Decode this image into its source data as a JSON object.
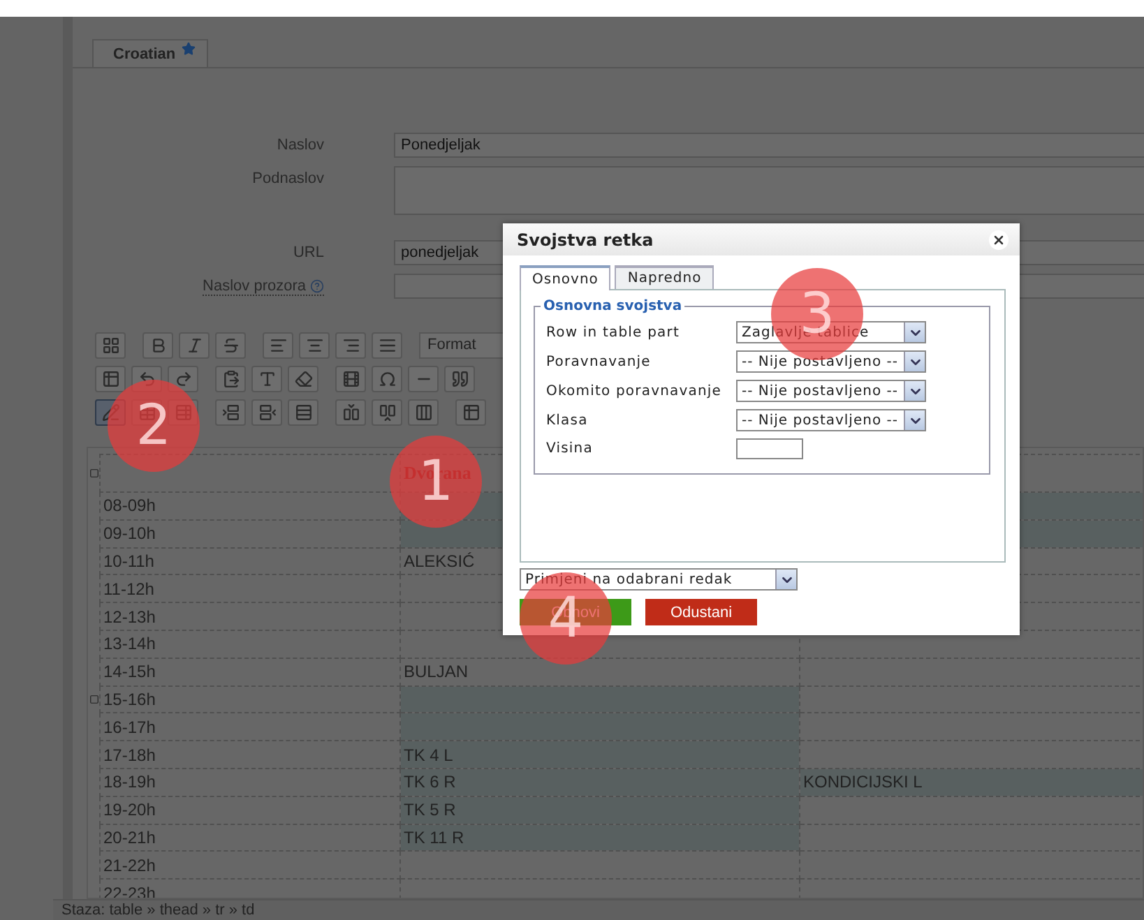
{
  "tab": {
    "label": "Croatian"
  },
  "form": [
    {
      "label": "Naslov",
      "kind": "input",
      "value": "Ponedjeljak",
      "help": false
    },
    {
      "label": "Podnaslov",
      "kind": "textarea",
      "help": false
    },
    {
      "label": "URL",
      "kind": "input",
      "value": "ponedjeljak",
      "help": false
    },
    {
      "label": "Naslov prozora",
      "kind": "input",
      "help": true
    }
  ],
  "toolbar": {
    "rows": [
      [
        [
          {
            "kind": "source",
            "pressed": false
          }
        ],
        [
          {
            "kind": "bold",
            "pressed": false
          },
          {
            "kind": "italic",
            "pressed": false
          },
          {
            "kind": "strike",
            "pressed": false
          }
        ],
        [
          {
            "kind": "align-left",
            "pressed": false
          },
          {
            "kind": "align-center",
            "pressed": false
          },
          {
            "kind": "align-right",
            "pressed": false
          },
          {
            "kind": "justify",
            "pressed": false
          }
        ],
        [
          {
            "kind": "select",
            "label": "Format",
            "pressed": false
          }
        ]
      ],
      [
        [
          {
            "kind": "table",
            "pressed": false
          },
          {
            "kind": "undo",
            "pressed": false
          },
          {
            "kind": "redo",
            "pressed": false
          }
        ],
        [
          {
            "kind": "paste",
            "pressed": false
          },
          {
            "kind": "paste-text",
            "pressed": false
          },
          {
            "kind": "eraser",
            "pressed": false
          }
        ],
        [
          {
            "kind": "film",
            "pressed": false
          },
          {
            "kind": "omega",
            "pressed": false
          },
          {
            "kind": "rule",
            "pressed": false
          },
          {
            "kind": "quote",
            "pressed": false
          }
        ]
      ],
      [
        [
          {
            "kind": "row-props",
            "pressed": true
          },
          {
            "kind": "cell-props",
            "pressed": false
          },
          {
            "kind": "table-props",
            "pressed": false
          }
        ],
        [
          {
            "kind": "row-before",
            "pressed": false
          },
          {
            "kind": "row-after",
            "pressed": false
          },
          {
            "kind": "row-delete",
            "pressed": false
          }
        ],
        [
          {
            "kind": "col-before",
            "pressed": false
          },
          {
            "kind": "col-after",
            "pressed": false
          },
          {
            "kind": "col-delete",
            "pressed": false
          }
        ],
        [
          {
            "kind": "table",
            "pressed": false
          }
        ]
      ]
    ]
  },
  "table": {
    "header": {
      "marked": true,
      "cells": [
        {
          "highlighted": false
        },
        {
          "text": "Dvorana",
          "highlighted": false
        },
        {
          "highlighted": false
        }
      ]
    },
    "rows": [
      {
        "marked": false,
        "cells": [
          {
            "text": "08-09h",
            "highlighted": false
          },
          {
            "highlighted": true
          },
          {
            "highlighted": true
          }
        ]
      },
      {
        "marked": false,
        "cells": [
          {
            "text": "09-10h",
            "highlighted": false
          },
          {
            "highlighted": true
          },
          {
            "highlighted": true
          }
        ]
      },
      {
        "marked": false,
        "cells": [
          {
            "text": "10-11h",
            "highlighted": false
          },
          {
            "text": "ALEKSIĆ",
            "highlighted": false
          },
          {
            "highlighted": false
          }
        ]
      },
      {
        "marked": false,
        "cells": [
          {
            "text": "11-12h",
            "highlighted": false
          },
          {
            "highlighted": false
          },
          {
            "highlighted": false
          }
        ]
      },
      {
        "marked": false,
        "cells": [
          {
            "text": "12-13h",
            "highlighted": false
          },
          {
            "highlighted": false
          },
          {
            "highlighted": false
          }
        ]
      },
      {
        "marked": false,
        "cells": [
          {
            "text": "13-14h",
            "highlighted": false
          },
          {
            "highlighted": false
          },
          {
            "highlighted": false
          }
        ]
      },
      {
        "marked": false,
        "cells": [
          {
            "text": "14-15h",
            "highlighted": false
          },
          {
            "text": "BULJAN",
            "highlighted": false
          },
          {
            "highlighted": false
          }
        ]
      },
      {
        "marked": true,
        "cells": [
          {
            "text": "15-16h",
            "highlighted": false
          },
          {
            "highlighted": true
          },
          {
            "highlighted": false
          }
        ]
      },
      {
        "marked": false,
        "cells": [
          {
            "text": "16-17h",
            "highlighted": false
          },
          {
            "highlighted": true
          },
          {
            "highlighted": false
          }
        ]
      },
      {
        "marked": false,
        "cells": [
          {
            "text": "17-18h",
            "highlighted": false
          },
          {
            "text": "TK 4 L",
            "highlighted": true
          },
          {
            "highlighted": false
          }
        ]
      },
      {
        "marked": false,
        "cells": [
          {
            "text": "18-19h",
            "highlighted": false
          },
          {
            "text": "TK 6 R",
            "highlighted": true
          },
          {
            "text": "KONDICIJSKI L",
            "highlighted": true
          }
        ]
      },
      {
        "marked": false,
        "cells": [
          {
            "text": "19-20h",
            "highlighted": false
          },
          {
            "text": "TK 5 R",
            "highlighted": true
          },
          {
            "highlighted": false
          }
        ]
      },
      {
        "marked": false,
        "cells": [
          {
            "text": "20-21h",
            "highlighted": false
          },
          {
            "text": "TK 11 R",
            "highlighted": true
          },
          {
            "highlighted": false
          }
        ]
      },
      {
        "marked": false,
        "cells": [
          {
            "text": "21-22h",
            "highlighted": false
          },
          {
            "highlighted": false
          },
          {
            "highlighted": false
          }
        ]
      },
      {
        "marked": false,
        "cells": [
          {
            "text": "22-23h",
            "highlighted": false
          },
          {
            "highlighted": false
          },
          {
            "highlighted": false
          }
        ]
      }
    ]
  },
  "status_bar": "Staza: table » thead » tr » td",
  "dialog": {
    "title": "Svojstva retka",
    "tabs": [
      {
        "label": "Osnovno",
        "selected": true
      },
      {
        "label": "Napredno",
        "selected": false
      }
    ],
    "legend": "Osnovna svojstva",
    "fields": [
      {
        "label": "Row in table part",
        "kind": "select",
        "value": "Zaglavlje tablice"
      },
      {
        "label": "Poravnavanje",
        "kind": "select",
        "value": "-- Nije postavljeno --"
      },
      {
        "label": "Okomito poravnavanje",
        "kind": "select",
        "value": "-- Nije postavljeno --"
      },
      {
        "label": "Klasa",
        "kind": "select",
        "value": "-- Nije postavljeno --"
      },
      {
        "label": "Visina",
        "kind": "input"
      }
    ],
    "apply_select": "Primjeni na odabrani redak",
    "buttons": [
      {
        "label": "Obnovi",
        "kind": "ok"
      },
      {
        "label": "Odustani",
        "kind": "cancel"
      }
    ]
  },
  "annotations": [
    {
      "label": "1"
    },
    {
      "label": "2"
    },
    {
      "label": "3"
    },
    {
      "label": "4"
    }
  ]
}
